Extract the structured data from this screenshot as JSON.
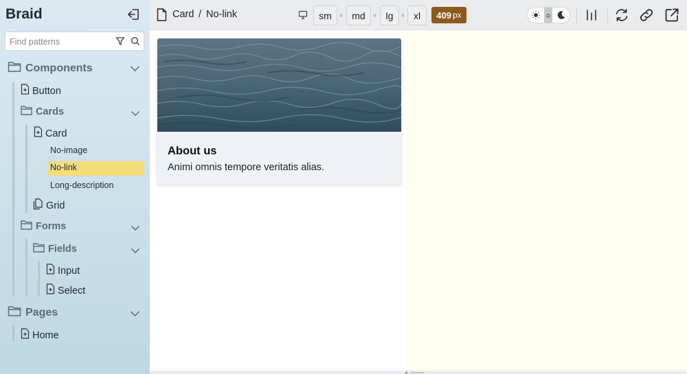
{
  "sidebar": {
    "brand": "Braid",
    "search": {
      "placeholder": "Find patterns"
    },
    "groups": {
      "components": "Components",
      "pages": "Pages"
    },
    "items": {
      "button": "Button",
      "cards": "Cards",
      "card": "Card",
      "no_image": "No-image",
      "no_link": "No-link",
      "long_description": "Long-description",
      "grid": "Grid",
      "forms": "Forms",
      "fields": "Fields",
      "input": "Input",
      "select": "Select",
      "home": "Home"
    },
    "active_story": "No-link"
  },
  "toolbar": {
    "breadcrumb": {
      "component": "Card",
      "separator": "/",
      "story": "No-link"
    },
    "breakpoints": [
      "sm",
      "md",
      "lg",
      "xl"
    ],
    "width": {
      "value": "409",
      "unit": "px"
    },
    "colors": {
      "badge": "#8c5a1a",
      "highlight": "#f5dc78"
    }
  },
  "preview": {
    "card": {
      "title": "About us",
      "description": "Animi omnis tempore veritatis alias."
    }
  }
}
